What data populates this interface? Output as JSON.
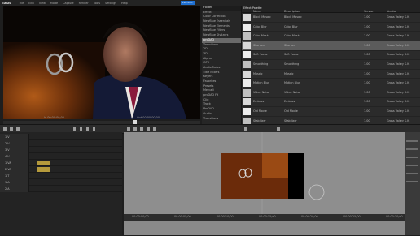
{
  "app": {
    "logo": "EDIUS",
    "menus": [
      "File",
      "Edit",
      "View",
      "Mode",
      "Capture",
      "Render",
      "Tools",
      "Settings",
      "Help"
    ],
    "badge": "PLR REC"
  },
  "player": {
    "timecode_in": "In 00:00:00;00",
    "timecode_out": "Out 00:00:00;00",
    "progress": 0.68
  },
  "tree": {
    "header": "Folder",
    "items": [
      {
        "label": "Effect",
        "selected": false
      },
      {
        "label": "Color Correction",
        "selected": false
      },
      {
        "label": "NewBlue Essentials",
        "selected": false
      },
      {
        "label": "NewBlue Elements",
        "selected": false
      },
      {
        "label": "NewBlue Filters",
        "selected": false
      },
      {
        "label": "NewBlue Stylizers",
        "selected": false
      },
      {
        "label": "proDAD",
        "selected": true
      },
      {
        "label": "Transitions",
        "selected": false
      },
      {
        "label": "2D",
        "selected": false
      },
      {
        "label": "3D",
        "selected": false
      },
      {
        "label": "Alpha",
        "selected": false
      },
      {
        "label": "GPU",
        "selected": false
      },
      {
        "label": "Audio Fades",
        "selected": false
      },
      {
        "label": "Title Mixers",
        "selected": false
      },
      {
        "label": "Keyers",
        "selected": false
      },
      {
        "label": "Favorites",
        "selected": false
      },
      {
        "label": "Presets",
        "selected": false
      },
      {
        "label": "Mercalli",
        "selected": false
      },
      {
        "label": "proDAD FX",
        "selected": false
      },
      {
        "label": "Clip",
        "selected": false
      },
      {
        "label": "Track",
        "selected": false
      },
      {
        "label": "ProDAD",
        "selected": false
      },
      {
        "label": "Audio",
        "selected": false
      },
      {
        "label": "Transitions",
        "selected": false
      },
      {
        "label": "Filters",
        "selected": false
      }
    ]
  },
  "effects": {
    "title": "Effect Palette",
    "columns": [
      "Name",
      "Description",
      "Version",
      "Vendor"
    ],
    "rows": [
      {
        "name": "Block Mosaic",
        "desc": "Block Mosaic",
        "ver": "1.00",
        "vendor": "Grass Valley K.K."
      },
      {
        "name": "Color Blur",
        "desc": "Color Blur",
        "ver": "1.00",
        "vendor": "Grass Valley K.K."
      },
      {
        "name": "Color Mask",
        "desc": "Color Mask",
        "ver": "1.00",
        "vendor": "Grass Valley K.K."
      },
      {
        "name": "Sharpen",
        "desc": "Sharpen",
        "ver": "1.00",
        "vendor": "Grass Valley K.K."
      },
      {
        "name": "Soft Focus",
        "desc": "Soft Focus",
        "ver": "1.00",
        "vendor": "Grass Valley K.K."
      },
      {
        "name": "Smoothing",
        "desc": "Smoothing",
        "ver": "1.00",
        "vendor": "Grass Valley K.K."
      },
      {
        "name": "Mosaic",
        "desc": "Mosaic",
        "ver": "1.00",
        "vendor": "Grass Valley K.K."
      },
      {
        "name": "Motion Blur",
        "desc": "Motion Blur",
        "ver": "1.00",
        "vendor": "Grass Valley K.K."
      },
      {
        "name": "Video Noise",
        "desc": "Video Noise",
        "ver": "1.00",
        "vendor": "Grass Valley K.K."
      },
      {
        "name": "Emboss",
        "desc": "Emboss",
        "ver": "1.00",
        "vendor": "Grass Valley K.K."
      },
      {
        "name": "Old Movie",
        "desc": "Old Movie",
        "ver": "1.00",
        "vendor": "Grass Valley K.K."
      },
      {
        "name": "Stabilizer",
        "desc": "Stabilizer",
        "ver": "1.00",
        "vendor": "Grass Valley K.K."
      }
    ]
  },
  "timeline": {
    "tracks": [
      "1 V",
      "2 V",
      "3 V",
      "4 V",
      "1 VA",
      "2 VA",
      "1 T",
      "1 A",
      "2 A"
    ],
    "ruler": [
      "00:00:00;00",
      "00:00:05;00",
      "00:00:10;00",
      "00:00:15;00",
      "00:00:20;00",
      "00:00:25;00",
      "00:00:30;00"
    ]
  },
  "colors": {
    "accent": "#1f6fd1",
    "panel": "#2b2b2b",
    "selection": "#5b5b5b",
    "clip_audio": "#b59a3c"
  }
}
